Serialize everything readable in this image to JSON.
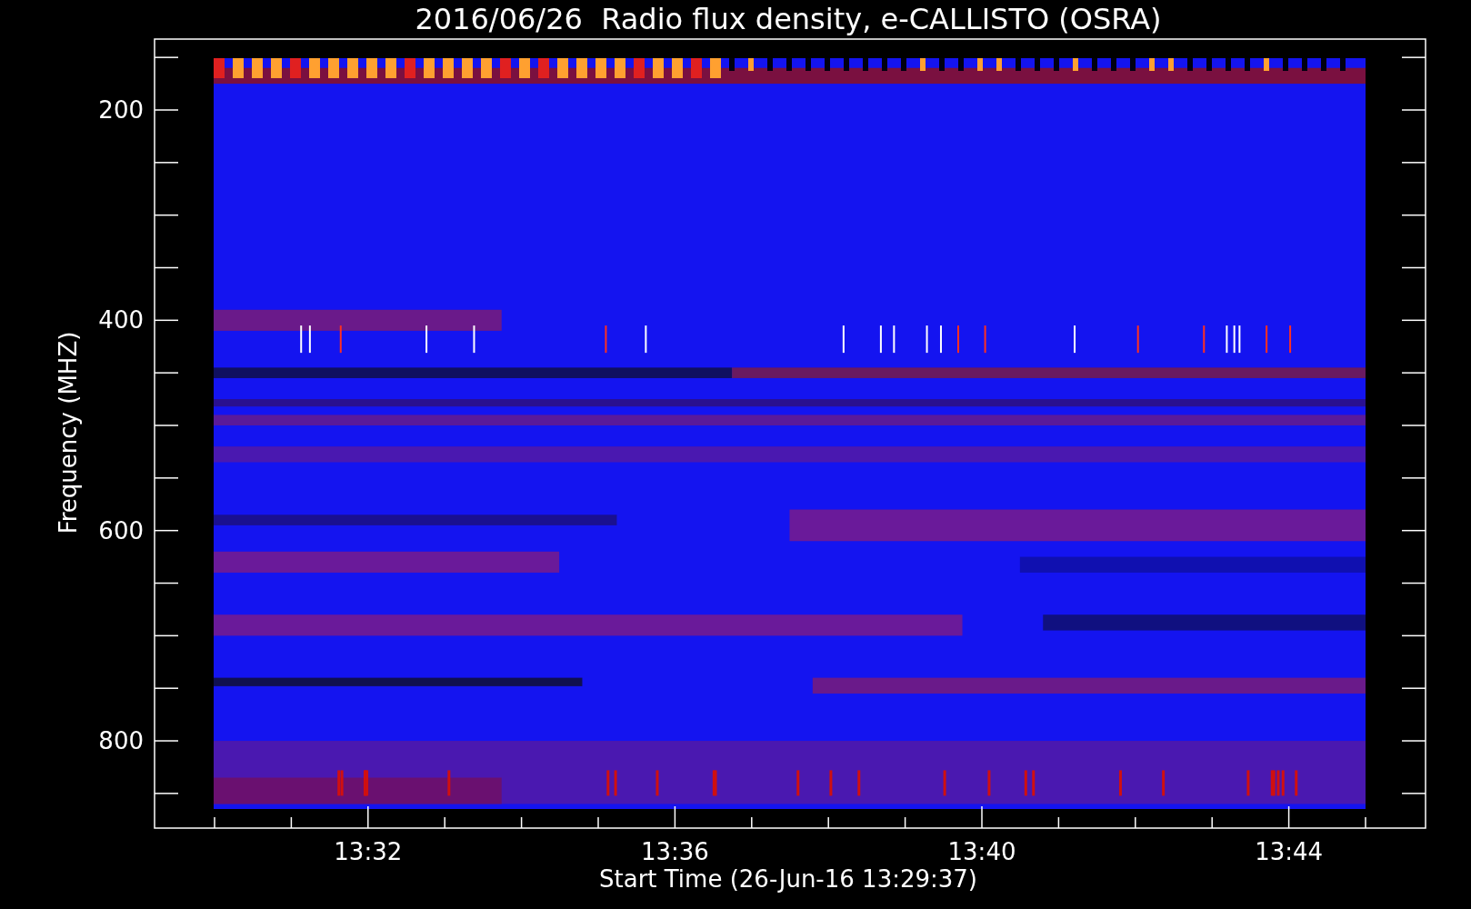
{
  "title": "2016/06/26  Radio flux density, e-CALLISTO (OSRA)",
  "ylabel": "Frequency (MHZ)",
  "xlabel": "Start Time (26-Jun-16 13:29:37)",
  "yticks": [
    "200",
    "400",
    "600",
    "800"
  ],
  "xticks": [
    "13:32",
    "13:36",
    "13:40",
    "13:44"
  ]
}
